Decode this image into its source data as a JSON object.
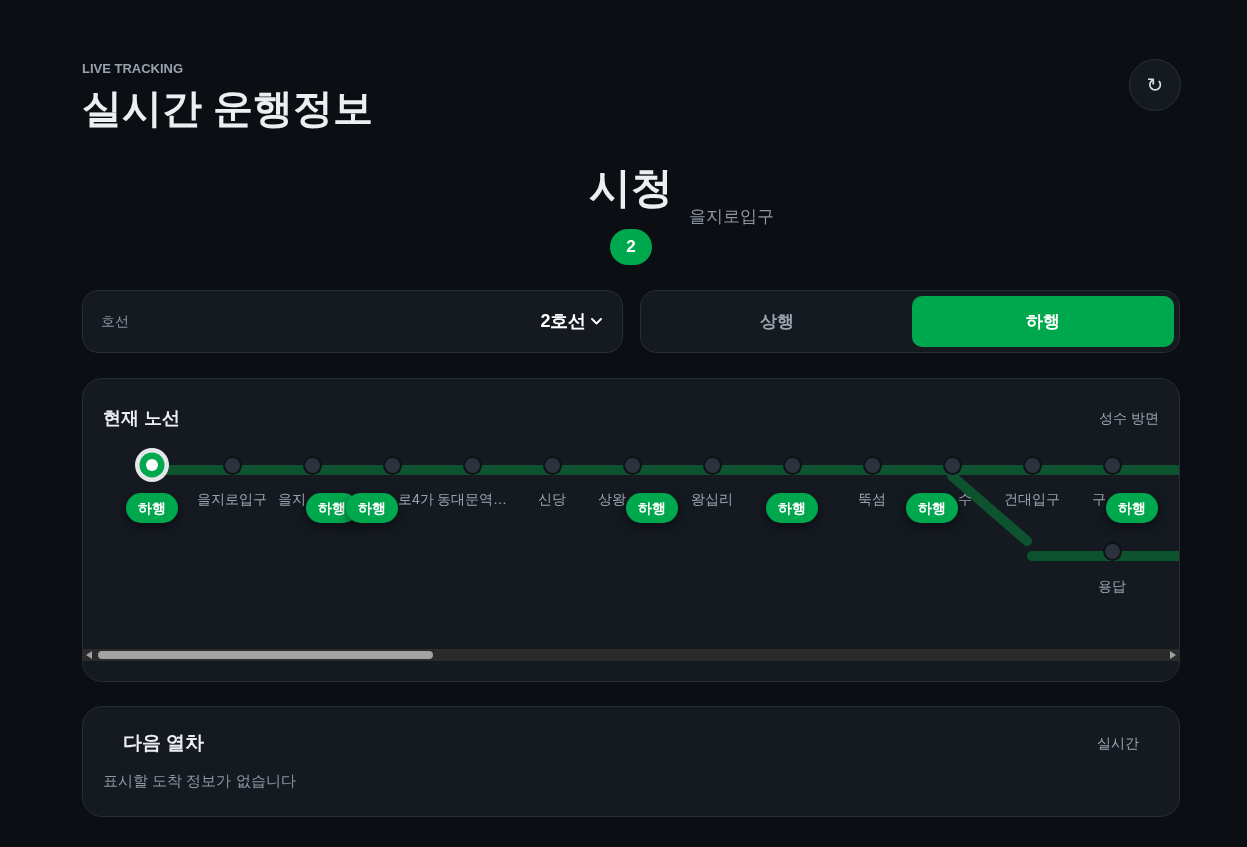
{
  "header": {
    "eyebrow": "LIVE TRACKING",
    "title": "실시간 운행정보",
    "refresh_button": "↻"
  },
  "current_station": {
    "name": "시청",
    "next_station": "을지로입구",
    "line_badge": "2"
  },
  "line_selector": {
    "label": "호선",
    "value": "2호선"
  },
  "direction_tabs": [
    {
      "label": "상행",
      "selected": false
    },
    {
      "label": "하행",
      "selected": true
    }
  ],
  "route_map": {
    "title": "현재 노선",
    "direction": "성수 방면",
    "stations": [
      {
        "selected": true,
        "trains": [
          {
            "label": "하행",
            "kind": "at"
          }
        ]
      },
      {
        "label": "을지로입구",
        "selected": false
      },
      {
        "label": "을지",
        "selected": false,
        "trains": [
          {
            "label": "하행",
            "kind": "departed"
          }
        ]
      },
      {
        "label": "로4가",
        "selected": false,
        "trains": [
          {
            "label": "하행",
            "kind": "arriving"
          }
        ]
      },
      {
        "label": "동대문역…",
        "selected": false
      },
      {
        "label": "신당",
        "selected": false
      },
      {
        "label": "상왕",
        "selected": false,
        "trains": [
          {
            "label": "하행",
            "kind": "departed"
          }
        ]
      },
      {
        "label": "왕십리",
        "selected": false
      },
      {
        "selected": false,
        "trains": [
          {
            "label": "하행",
            "kind": "at"
          }
        ]
      },
      {
        "label": "뚝섬",
        "selected": false
      },
      {
        "label": "수",
        "selected": false,
        "trains": [
          {
            "label": "하행",
            "kind": "arriving"
          }
        ],
        "branch": {
          "stations": [
            {
              "label": "용답",
              "selected": false
            }
          ]
        }
      },
      {
        "label": "건대입구",
        "selected": false
      },
      {
        "label": "구",
        "selected": false,
        "trains": [
          {
            "label": "하행",
            "kind": "departed"
          }
        ]
      }
    ]
  },
  "next_train": {
    "title": "다음 열차",
    "mode": "실시간",
    "empty_message": "표시할 도착 정보가 없습니다"
  }
}
